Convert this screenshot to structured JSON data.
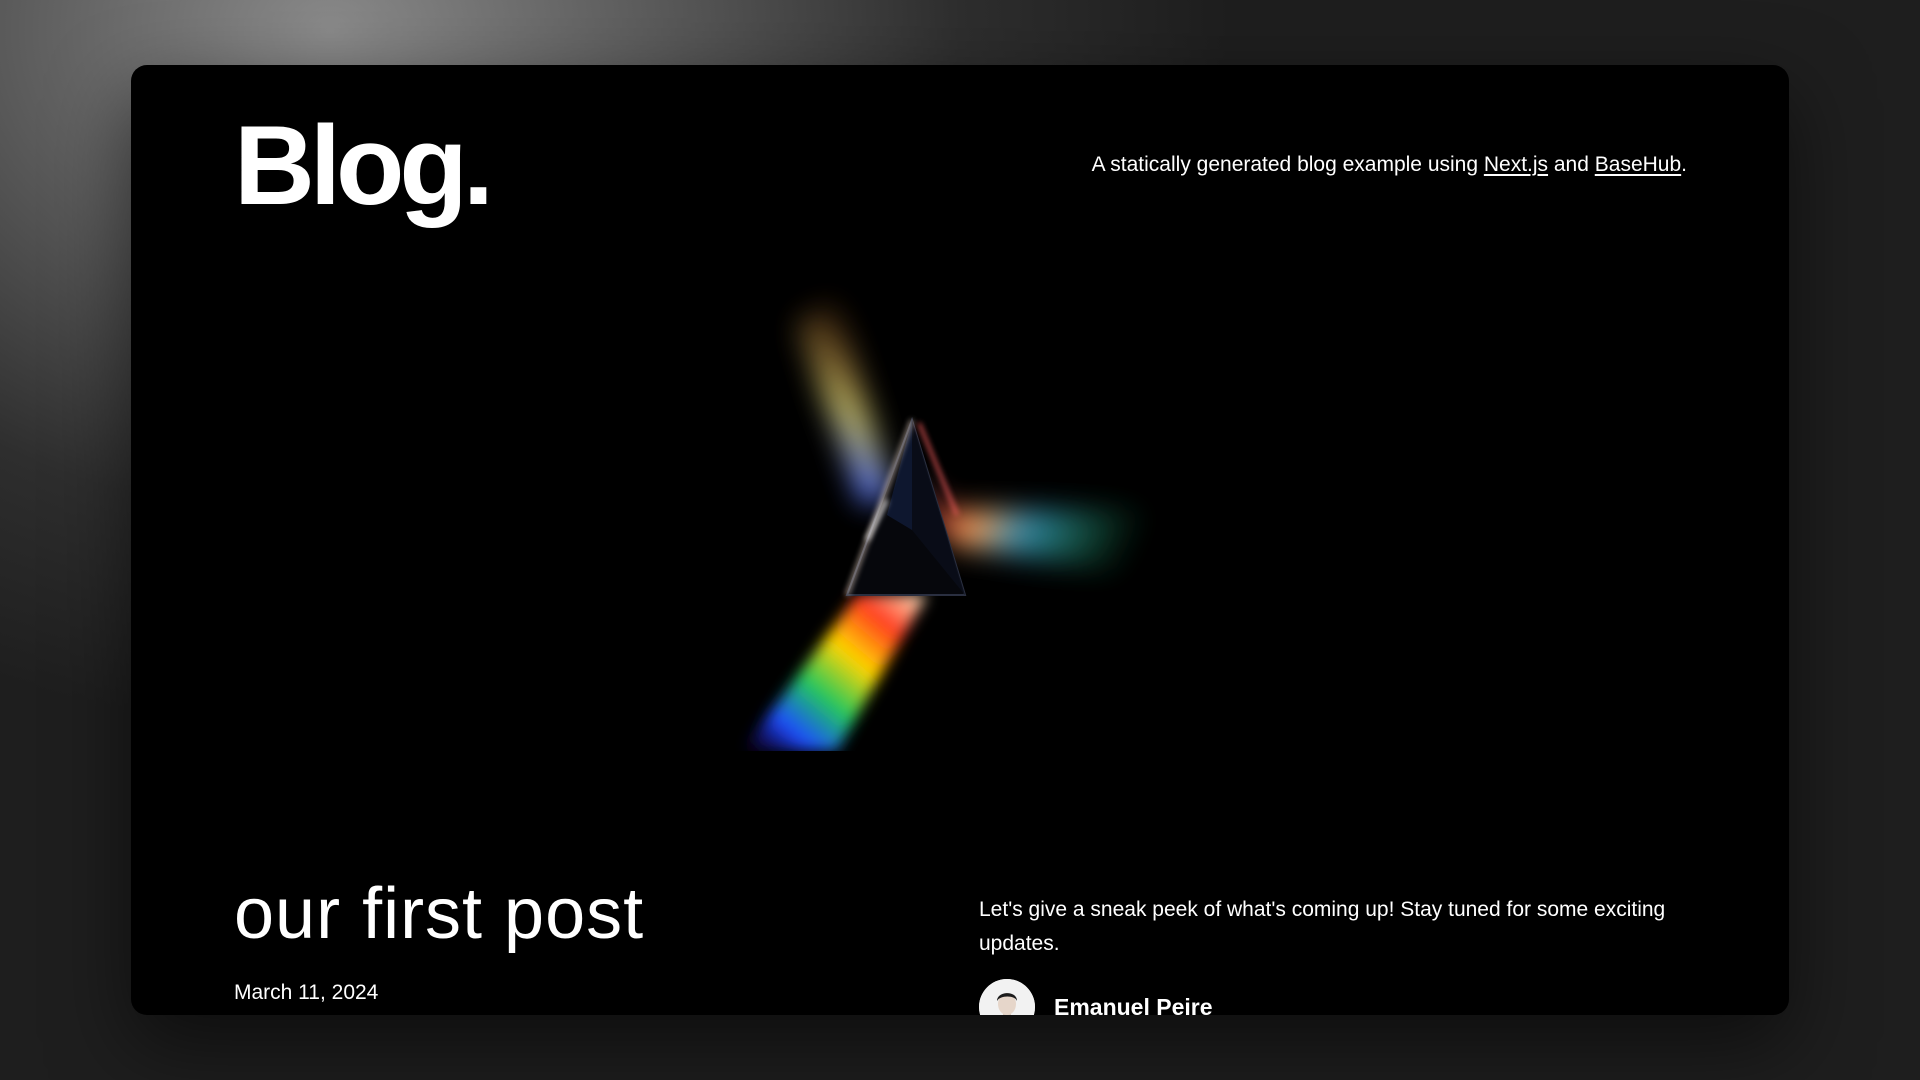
{
  "header": {
    "logo": "Blog.",
    "tagline_prefix": "A statically generated blog example using ",
    "link_nextjs": "Next.js",
    "tagline_and": " and ",
    "link_basehub": "BaseHub",
    "tagline_suffix": "."
  },
  "hero_post": {
    "title": "our first post",
    "date": "March 11, 2024",
    "excerpt": "Let's give a sneak peek of what's coming up! Stay tuned for some exciting updates.",
    "author": {
      "name": "Emanuel Peire"
    }
  },
  "colors": {
    "card_background": "#000000",
    "text": "#ffffff"
  },
  "icons": {
    "hero_image": "prism-rainbow-image",
    "avatar": "author-avatar"
  }
}
